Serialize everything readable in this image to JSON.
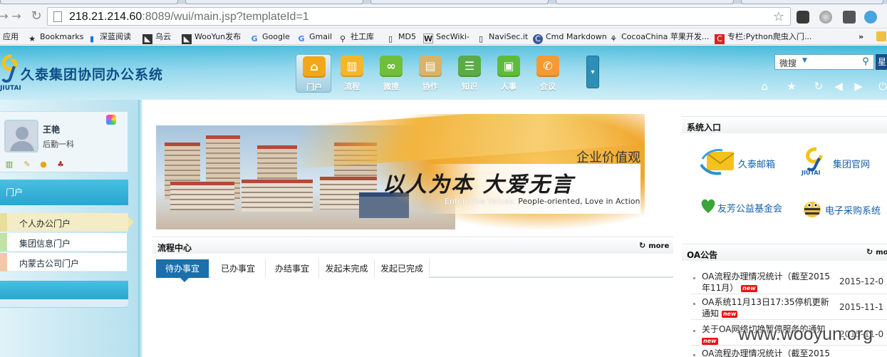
{
  "browser": {
    "url_host": "218.21.214.60",
    "url_rest": ":8089/wui/main.jsp?templateId=1",
    "bookmarks": [
      {
        "label": "应用",
        "icon": "apps-icon"
      },
      {
        "label": "Bookmarks",
        "icon": "star-icon"
      },
      {
        "label": "深蓝阅读",
        "icon": "bookmark-icon"
      },
      {
        "label": "乌云",
        "icon": "wooyun-icon"
      },
      {
        "label": "WooYun发布",
        "icon": "wooyun-icon"
      },
      {
        "label": "Google",
        "icon": "google-icon"
      },
      {
        "label": "Gmail",
        "icon": "google-icon"
      },
      {
        "label": "社工库",
        "icon": "search-icon"
      },
      {
        "label": "MD5",
        "icon": "page-icon"
      },
      {
        "label": "SecWiki-",
        "icon": "wiki-icon"
      },
      {
        "label": "NaviSec.it",
        "icon": "page-icon"
      },
      {
        "label": "Cmd Markdown",
        "icon": "cmd-icon"
      },
      {
        "label": "CocoaChina 苹果开发...",
        "icon": "cocoa-icon"
      },
      {
        "label": "专栏:Python爬虫入门...",
        "icon": "csdn-icon"
      }
    ],
    "bookmarks_overflow": "»"
  },
  "header": {
    "app_name": "久泰集团协同办公系统",
    "logo_sub": "JIUTAI",
    "nav": [
      {
        "label": "门户",
        "color": "#f2a71b",
        "glyph": "⌂",
        "active": true
      },
      {
        "label": "流程",
        "color": "#f5b72a",
        "glyph": "▥"
      },
      {
        "label": "微搜",
        "color": "#6fbf3a",
        "glyph": "∞"
      },
      {
        "label": "协作",
        "color": "#d7b46a",
        "glyph": "▤"
      },
      {
        "label": "知识",
        "color": "#5bab46",
        "glyph": "☰"
      },
      {
        "label": "人事",
        "color": "#5fbb3c",
        "glyph": "▣"
      },
      {
        "label": "会议",
        "color": "#f29b33",
        "glyph": "✆"
      }
    ],
    "search_scope": "微搜",
    "search_button": "星"
  },
  "sidebar": {
    "user_name": "王艳",
    "user_dept": "后勤一科",
    "section_label": "门户",
    "items": [
      {
        "label": "个人办公门户",
        "mark": "#e9df9b",
        "active": true
      },
      {
        "label": "集团信息门户",
        "mark": "#bfe3a3"
      },
      {
        "label": "内蒙古公司门户",
        "mark": "#f6c7a6"
      }
    ]
  },
  "banner": {
    "title": "企业价值观",
    "slogan": "以人为本  大爱无言",
    "en_prefix": "Enterprise Values:",
    "en_text": "People-oriented, Love in Action"
  },
  "flow": {
    "title": "流程中心",
    "more": "more",
    "tabs": [
      "待办事宜",
      "已办事宜",
      "办结事宜",
      "发起未完成",
      "发起已完成"
    ]
  },
  "system": {
    "title": "系统入口",
    "links": [
      {
        "label": "久泰邮箱",
        "icon": "mail-icon"
      },
      {
        "label": "集团官网",
        "icon": "jiutai-logo-icon"
      },
      {
        "label": "友芳公益基金会",
        "icon": "foundation-icon"
      },
      {
        "label": "电子采购系统",
        "icon": "bee-icon"
      }
    ],
    "jiutai_sub": "JIUTAI"
  },
  "notices": {
    "title": "OA公告",
    "more": "mo",
    "badge": "new",
    "items": [
      {
        "title": "OA流程办理情况统计（截至2015年11月）",
        "date": "2015-12-0"
      },
      {
        "title": "OA系统11月13日17:35停机更新通知",
        "date": "2015-11-1"
      },
      {
        "title": "关于OA网络切换暂停服务的通知",
        "date": "2015-11-0"
      },
      {
        "title": "OA流程办理情况统计（截至2015",
        "date": ""
      }
    ]
  },
  "watermark": "www.wooyun.org"
}
